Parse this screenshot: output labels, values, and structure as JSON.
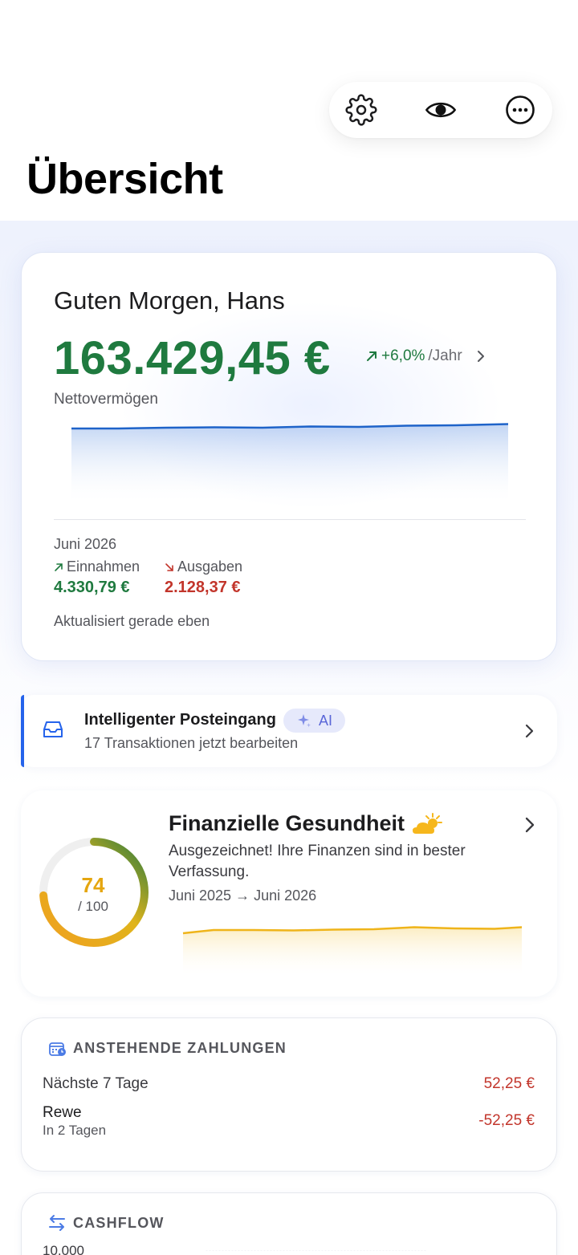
{
  "page": {
    "title": "Übersicht"
  },
  "toolbar": {
    "settings_icon": "gear-icon",
    "visibility_icon": "eye-icon",
    "more_icon": "ellipsis-circle-icon"
  },
  "networth": {
    "greeting": "Guten Morgen, Hans",
    "value": "163.429,45 €",
    "growth_pct": "+6,0%",
    "growth_period": "/Jahr",
    "label": "Nettovermögen",
    "month": "Juni 2026",
    "income_label": "Einnahmen",
    "income_value": "4.330,79 €",
    "expense_label": "Ausgaben",
    "expense_value": "2.128,37 €",
    "updated": "Aktualisiert gerade eben",
    "accent_color": "#1f7a3f",
    "line_color": "#1e63c9"
  },
  "inbox": {
    "title": "Intelligenter Posteingang",
    "badge": "AI",
    "subtitle": "17 Transaktionen jetzt bearbeiten"
  },
  "health": {
    "title": "Finanzielle Gesundheit",
    "score": "74",
    "score_of": "/ 100",
    "score_fraction": 0.74,
    "description": "Ausgezeichnet! Ihre Finanzen sind in bester Verfassung.",
    "range": "Juni 2025 → Juni 2026",
    "weather_icon": "sun-behind-cloud-icon"
  },
  "payments": {
    "heading": "ANSTEHENDE ZAHLUNGEN",
    "next_label": "Nächste 7 Tage",
    "next_total": "52,25 €",
    "items": [
      {
        "name": "Rewe",
        "when": "In 2 Tagen",
        "amount": "-52,25 €"
      }
    ]
  },
  "cashflow": {
    "heading": "CASHFLOW",
    "tick_top": "10.000"
  }
}
